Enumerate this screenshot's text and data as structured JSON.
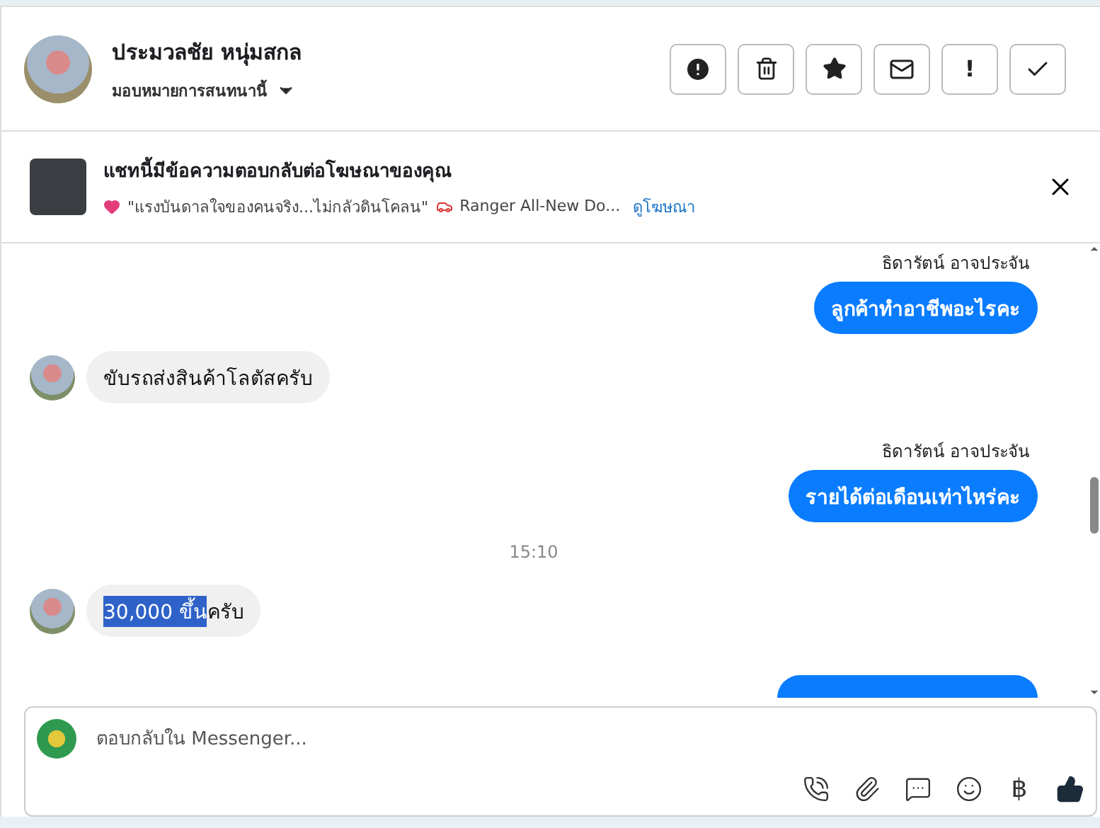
{
  "header": {
    "name": "ประมวลชัย หนุ่มสกล",
    "assign": "มอบหมายการสนทนานี้",
    "actions": [
      {
        "kind": "spam"
      },
      {
        "kind": "delete"
      },
      {
        "kind": "star"
      },
      {
        "kind": "unread"
      },
      {
        "kind": "important",
        "label": "!"
      },
      {
        "kind": "done"
      }
    ]
  },
  "ad_banner": {
    "title": "แชทนี้มีข้อความตอบกลับต่อโฆษณาของคุณ",
    "quote": "\"แรงบันดาลใจของคนจริง...ไม่กลัวดินโคลน\"",
    "product": "Ranger All-New Do...",
    "link": "ดูโฆษณา"
  },
  "messages": [
    {
      "kind": "outgoing",
      "sender": "ธิดารัตน์ อาจประจัน",
      "segments": [
        {
          "text": "ลูกค้าทำอาชีพอะไรคะ",
          "selected": false
        }
      ]
    },
    {
      "kind": "incoming",
      "segments": [
        {
          "text": "ขับรถส่งสินค้าโลตัสครับ",
          "selected": false
        }
      ]
    },
    {
      "kind": "outgoing",
      "sender": "ธิดารัตน์ อาจประจัน",
      "segments": [
        {
          "text": "รายได้ต่อเดือนเท่าไหร่คะ",
          "selected": false
        }
      ]
    },
    {
      "kind": "time",
      "text": "15:10"
    },
    {
      "kind": "incoming",
      "segments": [
        {
          "text": "30,000 ขึ้น",
          "selected": true
        },
        {
          "text": "ครับ",
          "selected": false
        }
      ]
    },
    {
      "kind": "outgoing_clipped"
    }
  ],
  "composer": {
    "placeholder": "ตอบกลับใน Messenger...",
    "tools": [
      {
        "kind": "call"
      },
      {
        "kind": "attach"
      },
      {
        "kind": "reply"
      },
      {
        "kind": "emoji"
      },
      {
        "kind": "baht",
        "label": "฿"
      },
      {
        "kind": "like"
      }
    ]
  }
}
